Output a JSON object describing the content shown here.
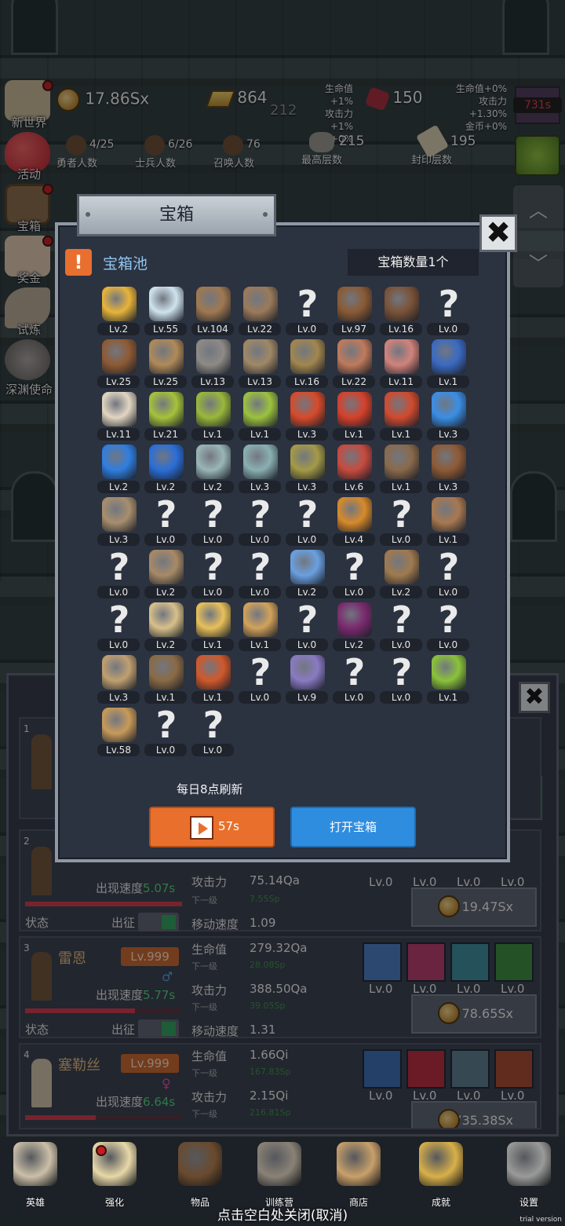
{
  "stats": {
    "gold": "17.86Sx",
    "gold_icon": "gold-coin-icon",
    "bars": "864",
    "bars_sub": "212",
    "bars_icon": "gold-bar-icon",
    "buff_left": [
      "生命值+1%",
      "攻击力+1%",
      "金币+0%"
    ],
    "gem": "150",
    "gem_icon": "red-gem-icon",
    "buff_right": [
      "生命值+0%",
      "攻击力+1.30%",
      "金币+0%"
    ],
    "hero_count": "4/25",
    "hero_label": "勇者人数",
    "soldier_count": "6/26",
    "soldier_label": "士兵人数",
    "summon_count": "76",
    "summon_label": "召唤人数",
    "max_floor": "215",
    "max_floor_label": "最高层数",
    "seal_floor": "195",
    "seal_floor_label": "封印层数",
    "timer": "731s"
  },
  "left_menu": [
    {
      "label": "新世界",
      "icon": "map-scroll-icon",
      "dot": true
    },
    {
      "label": "活动",
      "icon": "heart-icon",
      "dot": false
    },
    {
      "label": "宝箱",
      "icon": "treasure-chest-icon",
      "dot": true
    },
    {
      "label": "奖金",
      "icon": "envelope-icon",
      "dot": true
    },
    {
      "label": "试炼",
      "icon": "feather-icon",
      "dot": false
    },
    {
      "label": "深渊使命",
      "icon": "abyss-stone-icon",
      "dot": false
    }
  ],
  "modal": {
    "title": "宝箱",
    "pool_title": "宝箱池",
    "chest_count": "宝箱数量1个",
    "refresh": "每日8点刷新",
    "video_btn": "57s",
    "open_btn": "打开宝箱",
    "items": [
      {
        "lv": "Lv.2",
        "icon": "crown-icon",
        "c": "#e8b43a"
      },
      {
        "lv": "Lv.55",
        "icon": "diamond-icon",
        "c": "#cfe3ee"
      },
      {
        "lv": "Lv.104",
        "icon": "sword-icon",
        "c": "#a07850"
      },
      {
        "lv": "Lv.22",
        "icon": "short-sword-icon",
        "c": "#9a7a5a"
      },
      {
        "lv": "Lv.0",
        "icon": "unknown-icon",
        "q": true
      },
      {
        "lv": "Lv.97",
        "icon": "leather-armor-icon",
        "c": "#8a5a34"
      },
      {
        "lv": "Lv.16",
        "icon": "backpack-icon",
        "c": "#7a5236"
      },
      {
        "lv": "Lv.0",
        "icon": "unknown-icon",
        "q": true
      },
      {
        "lv": "Lv.25",
        "icon": "leather-helmet-icon",
        "c": "#8e5a34"
      },
      {
        "lv": "Lv.25",
        "icon": "dagger-icon",
        "c": "#b08a58"
      },
      {
        "lv": "Lv.13",
        "icon": "iron-helmet-icon",
        "c": "#8e8a86"
      },
      {
        "lv": "Lv.13",
        "icon": "hammer-icon",
        "c": "#a08866"
      },
      {
        "lv": "Lv.16",
        "icon": "knight-helmet-icon",
        "c": "#a2864e"
      },
      {
        "lv": "Lv.22",
        "icon": "meat-leg-icon",
        "c": "#c07a5c"
      },
      {
        "lv": "Lv.11",
        "icon": "steak-icon",
        "c": "#d2837a"
      },
      {
        "lv": "Lv.1",
        "icon": "blue-pouch-icon",
        "c": "#3a6ac2"
      },
      {
        "lv": "Lv.11",
        "icon": "rice-bowl-icon",
        "c": "#e2d6c2"
      },
      {
        "lv": "Lv.21",
        "icon": "green-potion-icon",
        "c": "#a6c23a"
      },
      {
        "lv": "Lv.1",
        "icon": "green-potion-icon",
        "c": "#9ab83a"
      },
      {
        "lv": "Lv.1",
        "icon": "green-potion-icon",
        "c": "#9cc23e"
      },
      {
        "lv": "Lv.3",
        "icon": "red-potion-icon",
        "c": "#d84a2a"
      },
      {
        "lv": "Lv.1",
        "icon": "red-potion-icon",
        "c": "#d6402a"
      },
      {
        "lv": "Lv.1",
        "icon": "red-potion-icon",
        "c": "#d24a2e"
      },
      {
        "lv": "Lv.3",
        "icon": "blue-potion-icon",
        "c": "#3a8ee6"
      },
      {
        "lv": "Lv.2",
        "icon": "blue-potion-icon",
        "c": "#2e7ee0"
      },
      {
        "lv": "Lv.2",
        "icon": "blue-potion-icon",
        "c": "#2a6ed8"
      },
      {
        "lv": "Lv.2",
        "icon": "silver-flask-icon",
        "c": "#9ab6b6"
      },
      {
        "lv": "Lv.3",
        "icon": "silver-flask-icon",
        "c": "#8ab0b2"
      },
      {
        "lv": "Lv.3",
        "icon": "olive-bottle-icon",
        "c": "#a49a46"
      },
      {
        "lv": "Lv.6",
        "icon": "red-vial-icon",
        "c": "#c84a3e"
      },
      {
        "lv": "Lv.1",
        "icon": "winged-boot-icon",
        "c": "#8a6a4a"
      },
      {
        "lv": "Lv.3",
        "icon": "leather-boot-icon",
        "c": "#8e5a34"
      },
      {
        "lv": "Lv.3",
        "icon": "cloth-boot-icon",
        "c": "#a88e6e"
      },
      {
        "lv": "Lv.0",
        "icon": "unknown-icon",
        "q": true
      },
      {
        "lv": "Lv.0",
        "icon": "unknown-icon",
        "q": true
      },
      {
        "lv": "Lv.0",
        "icon": "unknown-icon",
        "q": true
      },
      {
        "lv": "Lv.0",
        "icon": "unknown-icon",
        "q": true
      },
      {
        "lv": "Lv.4",
        "icon": "torch-icon",
        "c": "#d88a2a"
      },
      {
        "lv": "Lv.0",
        "icon": "unknown-icon",
        "q": true
      },
      {
        "lv": "Lv.1",
        "icon": "mushroom-icon",
        "c": "#a87850"
      },
      {
        "lv": "Lv.0",
        "icon": "unknown-icon",
        "q": true
      },
      {
        "lv": "Lv.2",
        "icon": "wooden-staff-icon",
        "c": "#a88a66"
      },
      {
        "lv": "Lv.0",
        "icon": "unknown-icon",
        "q": true
      },
      {
        "lv": "Lv.0",
        "icon": "unknown-icon",
        "q": true
      },
      {
        "lv": "Lv.2",
        "icon": "magic-wand-icon",
        "c": "#6aa0e0"
      },
      {
        "lv": "Lv.0",
        "icon": "unknown-icon",
        "q": true
      },
      {
        "lv": "Lv.2",
        "icon": "travel-bag-icon",
        "c": "#a07a4e"
      },
      {
        "lv": "Lv.0",
        "icon": "unknown-icon",
        "q": true
      },
      {
        "lv": "Lv.0",
        "icon": "unknown-icon",
        "q": true
      },
      {
        "lv": "Lv.2",
        "icon": "bone-club-icon",
        "c": "#d8c08a"
      },
      {
        "lv": "Lv.1",
        "icon": "cheese-icon",
        "c": "#e8c05a"
      },
      {
        "lv": "Lv.1",
        "icon": "pie-icon",
        "c": "#d2a25a"
      },
      {
        "lv": "Lv.0",
        "icon": "unknown-icon",
        "q": true
      },
      {
        "lv": "Lv.2",
        "icon": "wizard-hat-icon",
        "c": "#7a2a6e"
      },
      {
        "lv": "Lv.0",
        "icon": "unknown-icon",
        "q": true
      },
      {
        "lv": "Lv.0",
        "icon": "unknown-icon",
        "q": true
      },
      {
        "lv": "Lv.3",
        "icon": "bow-icon",
        "c": "#c0a070"
      },
      {
        "lv": "Lv.1",
        "icon": "crossbow-icon",
        "c": "#8a6a44"
      },
      {
        "lv": "Lv.1",
        "icon": "fire-shield-icon",
        "c": "#d2582a"
      },
      {
        "lv": "Lv.0",
        "icon": "unknown-icon",
        "q": true
      },
      {
        "lv": "Lv.9",
        "icon": "spirit-orb-icon",
        "c": "#8a7ac2"
      },
      {
        "lv": "Lv.0",
        "icon": "unknown-icon",
        "q": true
      },
      {
        "lv": "Lv.0",
        "icon": "unknown-icon",
        "q": true
      },
      {
        "lv": "Lv.1",
        "icon": "green-wand-icon",
        "c": "#8ac23a"
      },
      {
        "lv": "Lv.58",
        "icon": "beer-mug-icon",
        "c": "#c89a5a"
      },
      {
        "lv": "Lv.0",
        "icon": "unknown-icon",
        "q": true
      },
      {
        "lv": "Lv.0",
        "icon": "unknown-icon",
        "q": true
      }
    ]
  },
  "heroes": [
    {
      "no": "1"
    },
    {
      "no": "2",
      "speed_label": "出现速度",
      "speed": "5.07s",
      "status": "状态",
      "deploy": "出征",
      "atk_label": "攻击力",
      "atk": "75.14Qa",
      "atk_next_label": "下一级",
      "atk_next": "7.55Sp",
      "move_label": "移动速度",
      "move": "1.09",
      "skills": [
        "Lv.0",
        "Lv.0",
        "Lv.0",
        "Lv.0"
      ],
      "cost": "19.47Sx"
    },
    {
      "no": "3",
      "name": "雷恩",
      "lv": "Lv.999",
      "speed_label": "出现速度",
      "speed": "5.77s",
      "status": "状态",
      "deploy": "出征",
      "hp_label": "生命值",
      "hp": "279.32Qa",
      "hp_next_label": "下一级",
      "hp_next": "28.08Sp",
      "atk_label": "攻击力",
      "atk": "388.50Qa",
      "atk_next_label": "下一级",
      "atk_next": "39.05Sp",
      "move_label": "移动速度",
      "move": "1.31",
      "skills": [
        "Lv.0",
        "Lv.0",
        "Lv.0",
        "Lv.0"
      ],
      "cost": "78.65Sx"
    },
    {
      "no": "4",
      "name": "塞勒丝",
      "lv": "Lv.999",
      "speed_label": "出现速度",
      "speed": "6.64s",
      "hp_label": "生命值",
      "hp": "1.66Qi",
      "hp_next_label": "下一级",
      "hp_next": "167.83Sp",
      "atk_label": "攻击力",
      "atk": "2.15Qi",
      "atk_next_label": "下一级",
      "atk_next": "216.81Sp",
      "skills": [
        "Lv.0",
        "Lv.0",
        "Lv.0",
        "Lv.0"
      ],
      "cost": "735.38Sx"
    }
  ],
  "nav": [
    {
      "label": "英雄",
      "icon": "skull-icon",
      "c": "#cbbfa8",
      "dot": false
    },
    {
      "label": "强化",
      "icon": "candle-icon",
      "c": "#e8d8a8",
      "dot": true
    },
    {
      "label": "物品",
      "icon": "spellbook-icon",
      "c": "#6a4a2e",
      "dot": false
    },
    {
      "label": "训练营",
      "icon": "lantern-icon",
      "c": "#8a8276",
      "dot": false
    },
    {
      "label": "商店",
      "icon": "beer-mug-icon",
      "c": "#c8a06a",
      "dot": false
    },
    {
      "label": "成就",
      "icon": "golden-key-icon",
      "c": "#d8b04a",
      "dot": false
    },
    {
      "label": "设置",
      "icon": "gear-icon",
      "c": "#9a9a98",
      "dot": false
    }
  ],
  "hint": "点击空白处关闭(取消)",
  "trial": "trial version"
}
